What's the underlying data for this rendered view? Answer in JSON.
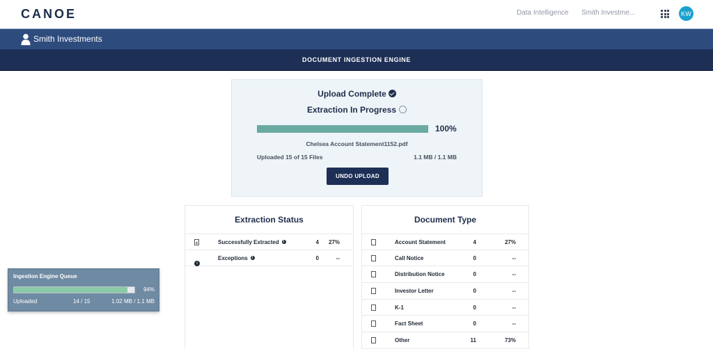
{
  "header": {
    "logo": "CANOE",
    "nav": [
      "Data Intelligence",
      "Smith Investme..."
    ],
    "apps_icon": "grid-icon",
    "avatar_initials": "KW",
    "avatar_color": "#1aa1cf"
  },
  "client": {
    "name": "Smith Investments",
    "icon": "person-icon",
    "bar_color": "#2e4b7e"
  },
  "title_bar": {
    "title": "DOCUMENT INGESTION ENGINE",
    "color": "#1d2f55"
  },
  "upload": {
    "status": "Upload Complete",
    "status_icon": "check-circle-icon",
    "extraction": "Extraction In Progress",
    "extraction_icon": "spinner-icon",
    "progress": 1.0,
    "progress_label": "100%",
    "progress_color": "#6aaaa2",
    "file_name": "Chelsea Account Statement1152.pdf",
    "files_uploaded": "Uploaded 15 of 15 Files",
    "size_uploaded": "1.1 MB / 1.1 MB",
    "undo_label": "UNDO UPLOAD"
  },
  "extraction_status": {
    "title": "Extraction Status",
    "rows": [
      {
        "icon": "document-icon",
        "label": "Successfully Extracted",
        "info": "i",
        "count": "4",
        "pct": "27%"
      },
      {
        "icon": "info-icon",
        "label": "Exceptions",
        "info": "i",
        "count": "0",
        "pct": "--"
      }
    ]
  },
  "document_type": {
    "title": "Document Type",
    "rows": [
      {
        "icon": "document-icon",
        "label": "Account Statement",
        "count": "4",
        "pct": "27%"
      },
      {
        "icon": "document-icon",
        "label": "Call Notice",
        "count": "0",
        "pct": "--"
      },
      {
        "icon": "document-icon",
        "label": "Distribution Notice",
        "count": "0",
        "pct": "--"
      },
      {
        "icon": "document-icon",
        "label": "Investor Letter",
        "count": "0",
        "pct": "--"
      },
      {
        "icon": "document-icon",
        "label": "K-1",
        "count": "0",
        "pct": "--"
      },
      {
        "icon": "document-icon",
        "label": "Fact Sheet",
        "count": "0",
        "pct": "--"
      },
      {
        "icon": "document-icon",
        "label": "Other",
        "count": "11",
        "pct": "73%"
      }
    ]
  },
  "queue": {
    "title": "Ingestion Engine Queue",
    "progress": 0.94,
    "progress_label": "94%",
    "progress_color": "#8cc9a6",
    "status": "Uploaded",
    "count": "14 / 15",
    "size": "1.02 MB / 1.1 MB",
    "bg_color": "#6f8aa3"
  }
}
